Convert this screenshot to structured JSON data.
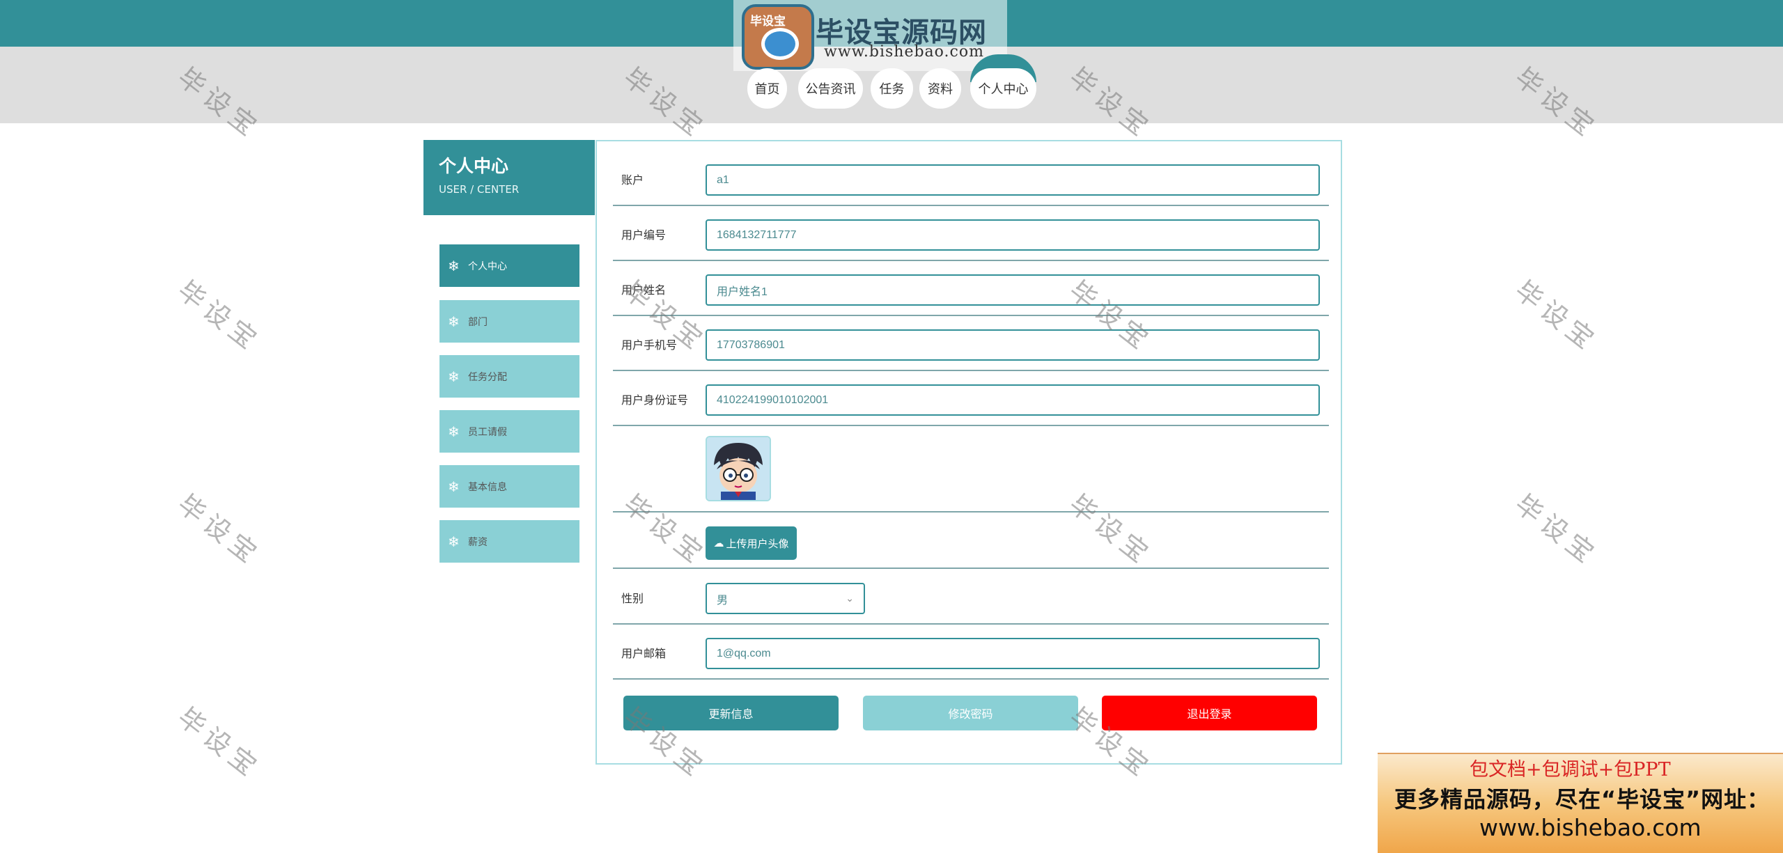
{
  "header": {
    "logo_tag": "毕设宝",
    "logo_title": "毕设宝源码网",
    "logo_url": "www.bishebao.com"
  },
  "nav": {
    "items": [
      "首页",
      "公告资讯",
      "任务",
      "资料",
      "个人中心"
    ],
    "active": "个人中心"
  },
  "sidebar": {
    "title": "个人中心",
    "subtitle": "USER / CENTER",
    "items": [
      "个人中心",
      "部门",
      "任务分配",
      "员工请假",
      "基本信息",
      "薪资"
    ],
    "active": "个人中心"
  },
  "form": {
    "account": {
      "label": "账户",
      "value": "a1"
    },
    "user_no": {
      "label": "用户编号",
      "value": "1684132711777"
    },
    "user_name": {
      "label": "用户姓名",
      "value": "用户姓名1"
    },
    "phone": {
      "label": "用户手机号",
      "value": "17703786901"
    },
    "id_card": {
      "label": "用户身份证号",
      "value": "410224199010102001"
    },
    "upload_label": "上传用户头像",
    "gender": {
      "label": "性别",
      "value": "男"
    },
    "email": {
      "label": "用户邮箱",
      "value": "1@qq.com"
    }
  },
  "buttons": {
    "update": "更新信息",
    "change_password": "修改密码",
    "logout": "退出登录"
  },
  "watermark": "毕设宝",
  "promo": {
    "line1": "包文档+包调试+包PPT",
    "line2": "更多精品源码，尽在“毕设宝”网址：",
    "line3": "www.bishebao.com"
  },
  "colors": {
    "primary": "#329098",
    "light": "#8ad0d5",
    "logout": "#ff0000",
    "nav_band": "#dedede"
  }
}
